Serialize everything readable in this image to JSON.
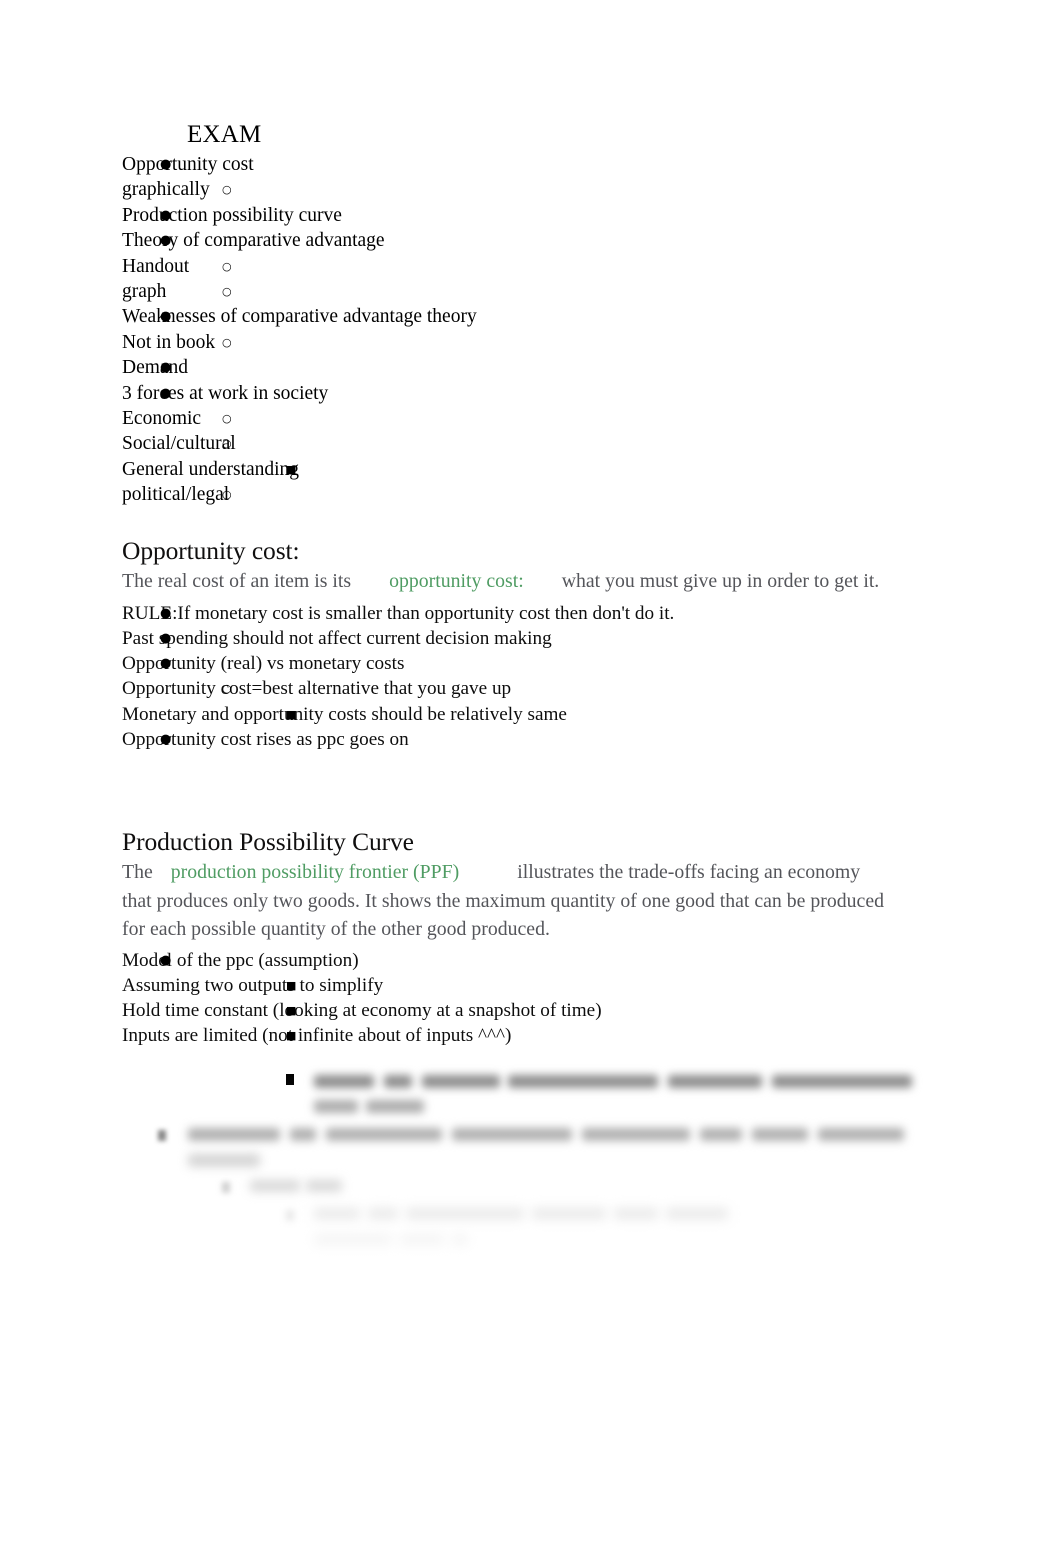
{
  "document": {
    "background_color": "#ffffff",
    "body_text_color": "#54555a",
    "heading_color": "#100f0f",
    "highlight_color": "#4f9c63"
  },
  "exam_outline": {
    "title": "EXAM",
    "items": [
      {
        "level": 1,
        "text": "Opportunity cost"
      },
      {
        "level": 2,
        "text": "graphically"
      },
      {
        "level": 1,
        "text": "Production possibility curve"
      },
      {
        "level": 1,
        "text": "Theory of comparative advantage"
      },
      {
        "level": 2,
        "text": "Handout"
      },
      {
        "level": 2,
        "text": "graph"
      },
      {
        "level": 1,
        "text": "Weaknesses of comparative advantage theory"
      },
      {
        "level": 2,
        "text": "Not in book"
      },
      {
        "level": 1,
        "text": "Demand"
      },
      {
        "level": 1,
        "text": "3 forces at work in society"
      },
      {
        "level": 2,
        "text": "Economic"
      },
      {
        "level": 2,
        "text": "Social/cultural"
      },
      {
        "level": 3,
        "text": "General understanding"
      },
      {
        "level": 2,
        "text": "political/legal"
      }
    ]
  },
  "opportunity_cost": {
    "heading": "Opportunity cost:",
    "definition_lead": "The real cost of an item is its",
    "definition_term": "opportunity cost:",
    "definition_tail": "what you must give up in order to get it.",
    "items": [
      {
        "level": 1,
        "text": "RULE:If monetary cost is smaller than opportunity cost then don't do it."
      },
      {
        "level": 1,
        "text": "Past spending should not affect current decision making"
      },
      {
        "level": 1,
        "text": "Opportunity (real) vs monetary costs"
      },
      {
        "level": 2,
        "text": "Opportunity cost=best alternative that you gave up"
      },
      {
        "level": 3,
        "text": "Monetary and opportunity costs should be relatively same"
      },
      {
        "level": 1,
        "text": "Opportunity cost rises as ppc goes on"
      }
    ]
  },
  "production_possibility_curve": {
    "heading": "Production Possibility Curve",
    "definition_lead": "The",
    "definition_term": "production possibility frontier (PPF)",
    "definition_tail": "illustrates the trade-offs facing an economy that produces only two goods. It shows the maximum quantity of one good that can be produced for each possible quantity of the other good produced.",
    "items": [
      {
        "level": 1,
        "text": "Model of the ppc (assumption)"
      },
      {
        "level": 3,
        "text": "Assuming two outputs to simplify"
      },
      {
        "level": 3,
        "text": "Hold time constant (looking at economy at a snapshot of time)"
      },
      {
        "level": 3,
        "text": "Inputs are limited (not infinite about of inputs ^^^)"
      }
    ]
  },
  "obscured_tail": {
    "note": "remaining lines are blurred and fade to white; text is not legible"
  },
  "bullets": {
    "disc": "●",
    "circle": "○",
    "square": "■"
  }
}
